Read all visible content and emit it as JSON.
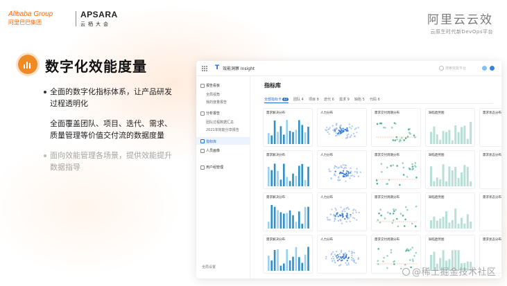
{
  "header": {
    "alibaba_logo": "Alibaba Group",
    "alibaba_logo_en": "Alibaba",
    "alibaba_logo_en2": "Group",
    "alibaba_logo_cn": "阿里巴巴集团",
    "apsara_logo": "APSARA",
    "apsara_logo_cn": "云栖大会",
    "right_title": "阿里云云效",
    "right_subtitle": "云原生时代新DevOps平台"
  },
  "section": {
    "icon": "bar-chart-icon",
    "title": "数字化效能度量",
    "bullets": [
      {
        "text": "全面的数字化指标体系，让产品研发过程透明化"
      },
      {
        "text": "全面覆盖团队、项目、迭代、需求、质量管理等价值交付流的数据度量"
      },
      {
        "text": "面向效能管理各场景，提供效能提升数据指导"
      }
    ]
  },
  "app": {
    "name": "效能洞察 Insight",
    "search_placeholder": "搜索效能平台",
    "sidebar": {
      "groups": [
        {
          "label": "报告看板",
          "items": [
            "全局视角",
            "我的度量报告"
          ]
        },
        {
          "label": "分析报告",
          "items": [
            "团队过程数据汇总",
            "2021年效能分享报告"
          ]
        }
      ],
      "active": "指标库",
      "extra": "人员画像",
      "admin": "用户组管理",
      "footer": "全局设置"
    },
    "main_title": "指标库",
    "tabs": [
      {
        "label": "全部指标卡",
        "count": "42"
      },
      {
        "label": "团队",
        "count": "4"
      },
      {
        "label": "项目",
        "count": "8"
      },
      {
        "label": "迭代",
        "count": "6"
      },
      {
        "label": "需求",
        "count": "9"
      },
      {
        "label": "缺陷",
        "count": "5"
      },
      {
        "label": "代码",
        "count": "6"
      }
    ],
    "card_titles": [
      "需求解决分布",
      "人力分布",
      "需求交付周期分布",
      "缺陷趋势图",
      "需求状态分布"
    ]
  },
  "watermark": "@稀土掘金技术社区",
  "colors": {
    "accent_orange": "#f08a24",
    "brand_orange": "#ff6a00",
    "app_blue": "#1e6fd9"
  }
}
